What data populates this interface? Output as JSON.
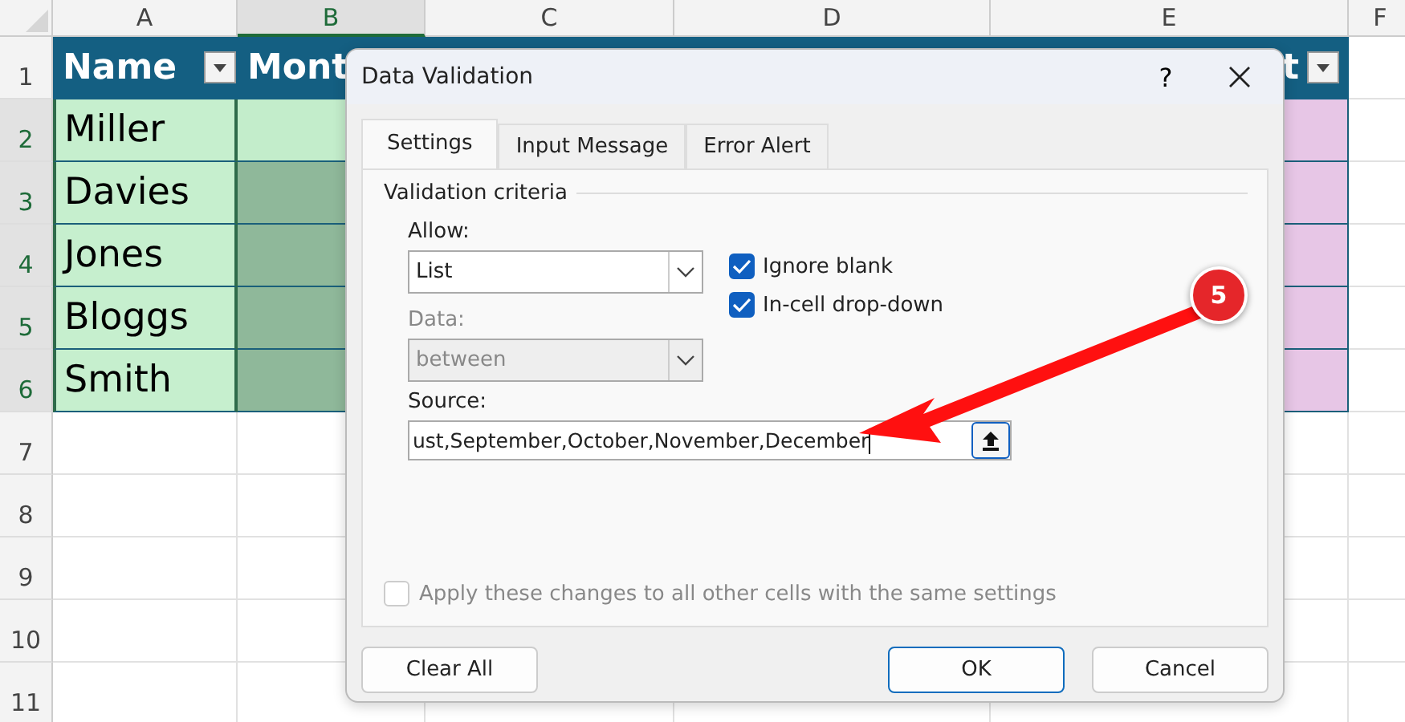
{
  "sheet": {
    "column_letters": [
      {
        "text": "A",
        "selected": false
      },
      {
        "text": "B",
        "selected": true
      },
      {
        "text": "C",
        "selected": false
      },
      {
        "text": "D",
        "selected": false
      },
      {
        "text": "E",
        "selected": false
      },
      {
        "text": "F",
        "selected": false
      }
    ],
    "row_numbers": [
      {
        "text": "1",
        "selected": false
      },
      {
        "text": "2",
        "selected": true
      },
      {
        "text": "3",
        "selected": true
      },
      {
        "text": "4",
        "selected": true
      },
      {
        "text": "5",
        "selected": true
      },
      {
        "text": "6",
        "selected": true
      },
      {
        "text": "7",
        "selected": false
      },
      {
        "text": "8",
        "selected": false
      },
      {
        "text": "9",
        "selected": false
      },
      {
        "text": "10",
        "selected": false
      },
      {
        "text": "11",
        "selected": false
      }
    ],
    "table_headers": [
      {
        "text": "Name"
      },
      {
        "text": "Mont"
      },
      {
        "text": "t"
      }
    ],
    "name_cells": [
      "Miller",
      "Davies",
      "Jones",
      "Bloggs",
      "Smith"
    ],
    "month_cells": [
      {
        "active": true
      },
      {
        "active": false
      },
      {
        "active": false
      },
      {
        "active": false
      },
      {
        "active": false
      }
    ]
  },
  "dialog": {
    "title": "Data Validation",
    "help": "?",
    "tabs": [
      {
        "label": "Settings",
        "selected": true
      },
      {
        "label": "Input Message",
        "selected": false
      },
      {
        "label": "Error Alert",
        "selected": false
      }
    ],
    "section": "Validation criteria",
    "allow": {
      "label": "Allow:",
      "value": "List",
      "disabled": false
    },
    "data": {
      "label": "Data:",
      "value": "between",
      "disabled": true
    },
    "options": [
      {
        "label": "Ignore blank",
        "checked": true
      },
      {
        "label": "In-cell drop-down",
        "checked": true
      }
    ],
    "source": {
      "label": "Source:",
      "value": "ust,September,October,November,December"
    },
    "apply": {
      "label": "Apply these changes to all other cells with the same settings",
      "checked": false,
      "disabled": true
    },
    "buttons": [
      {
        "label": "Clear All",
        "default": false
      },
      {
        "label": "OK",
        "default": true
      },
      {
        "label": "Cancel",
        "default": false
      }
    ]
  },
  "callout": {
    "text": "5"
  }
}
